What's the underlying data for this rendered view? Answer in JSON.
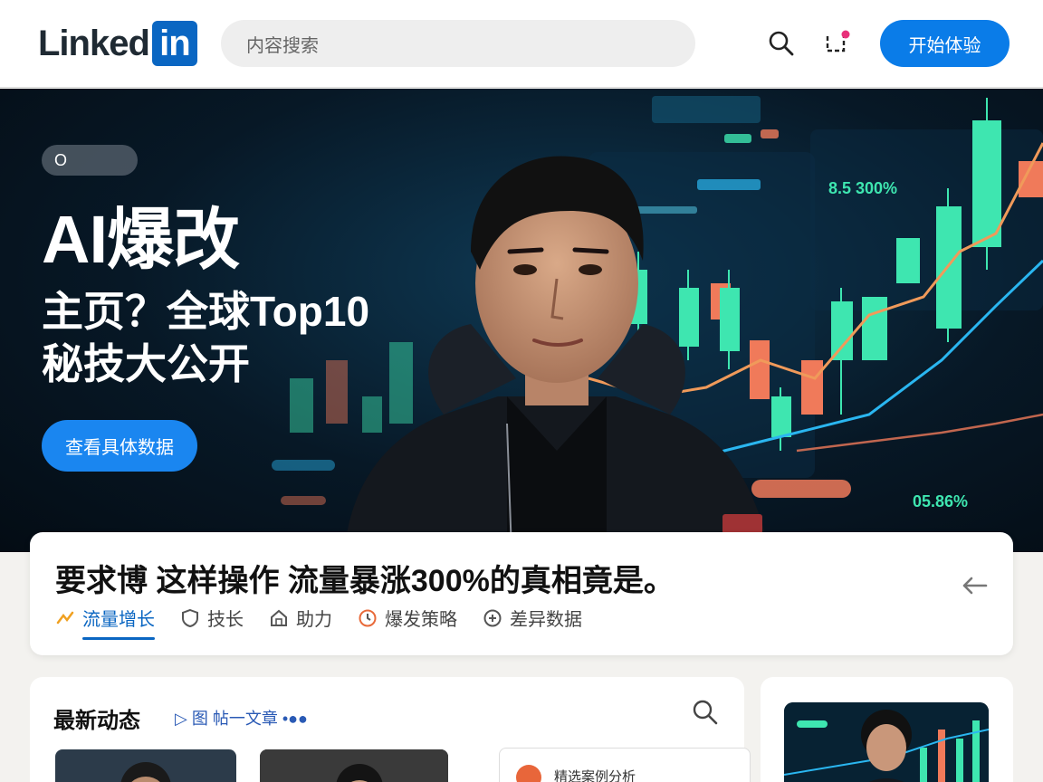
{
  "header": {
    "logo_text": "Linked",
    "logo_box": "in",
    "search_placeholder": "内容搜索",
    "cta_label": "开始体验",
    "icons": [
      "search-icon",
      "notification-icon"
    ]
  },
  "hero": {
    "pill_label": "O",
    "headline": "AI爆改",
    "subheadline_line1": "主页？全球Top10",
    "subheadline_line2": "秘技大公开",
    "button_label": "查看具体数据",
    "chart_labels": [
      "8.5 300%",
      "05.86%"
    ]
  },
  "article": {
    "title": "要求博 这样操作 流量暴涨300%的真相竟是。",
    "tabs": [
      {
        "label": "流量增长",
        "icon": "growth-icon",
        "active": true
      },
      {
        "label": "技长",
        "icon": "shield-icon",
        "active": false
      },
      {
        "label": "助力",
        "icon": "home-icon",
        "active": false
      },
      {
        "label": "爆发策略",
        "icon": "clock-icon",
        "active": false
      },
      {
        "label": "差异数据",
        "icon": "plus-icon",
        "active": false
      }
    ],
    "back_icon": "arrow-left-icon"
  },
  "feed": {
    "title": "最新动态",
    "subtitle": "▷ 图 帖一文章 •●●",
    "mini_card_text": "精选案例分析"
  },
  "colors": {
    "brand": "#0a66c2",
    "cta": "#0a7ce8",
    "hero_bg": "#071826",
    "candle_green": "#3ee6b0",
    "candle_red": "#f07a5a",
    "line_blue": "#2ab6f0"
  }
}
